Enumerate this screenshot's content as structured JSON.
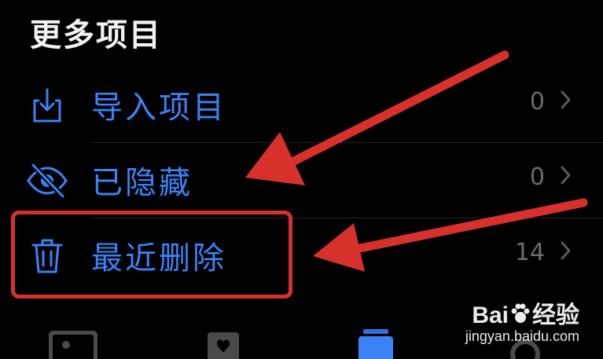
{
  "section": {
    "title": "更多项目"
  },
  "items": [
    {
      "label": "导入项目",
      "count": "0",
      "icon": "import-icon"
    },
    {
      "label": "已隐藏",
      "count": "0",
      "icon": "eye-slash-icon"
    },
    {
      "label": "最近删除",
      "count": "14",
      "icon": "trash-icon"
    }
  ],
  "colors": {
    "background": "#000000",
    "accent": "#3b82f6",
    "secondary_text": "#6b6b6b",
    "annotation_red": "#d8312c"
  },
  "tabbar": {
    "tabs": [
      {
        "icon": "photos-icon"
      },
      {
        "icon": "for-you-icon"
      },
      {
        "icon": "albums-icon",
        "selected": true
      },
      {
        "icon": "search-icon"
      }
    ]
  },
  "watermark": {
    "brand_prefix": "Bai",
    "brand_suffix": "经验",
    "url": "jingyan.baidu.com"
  }
}
